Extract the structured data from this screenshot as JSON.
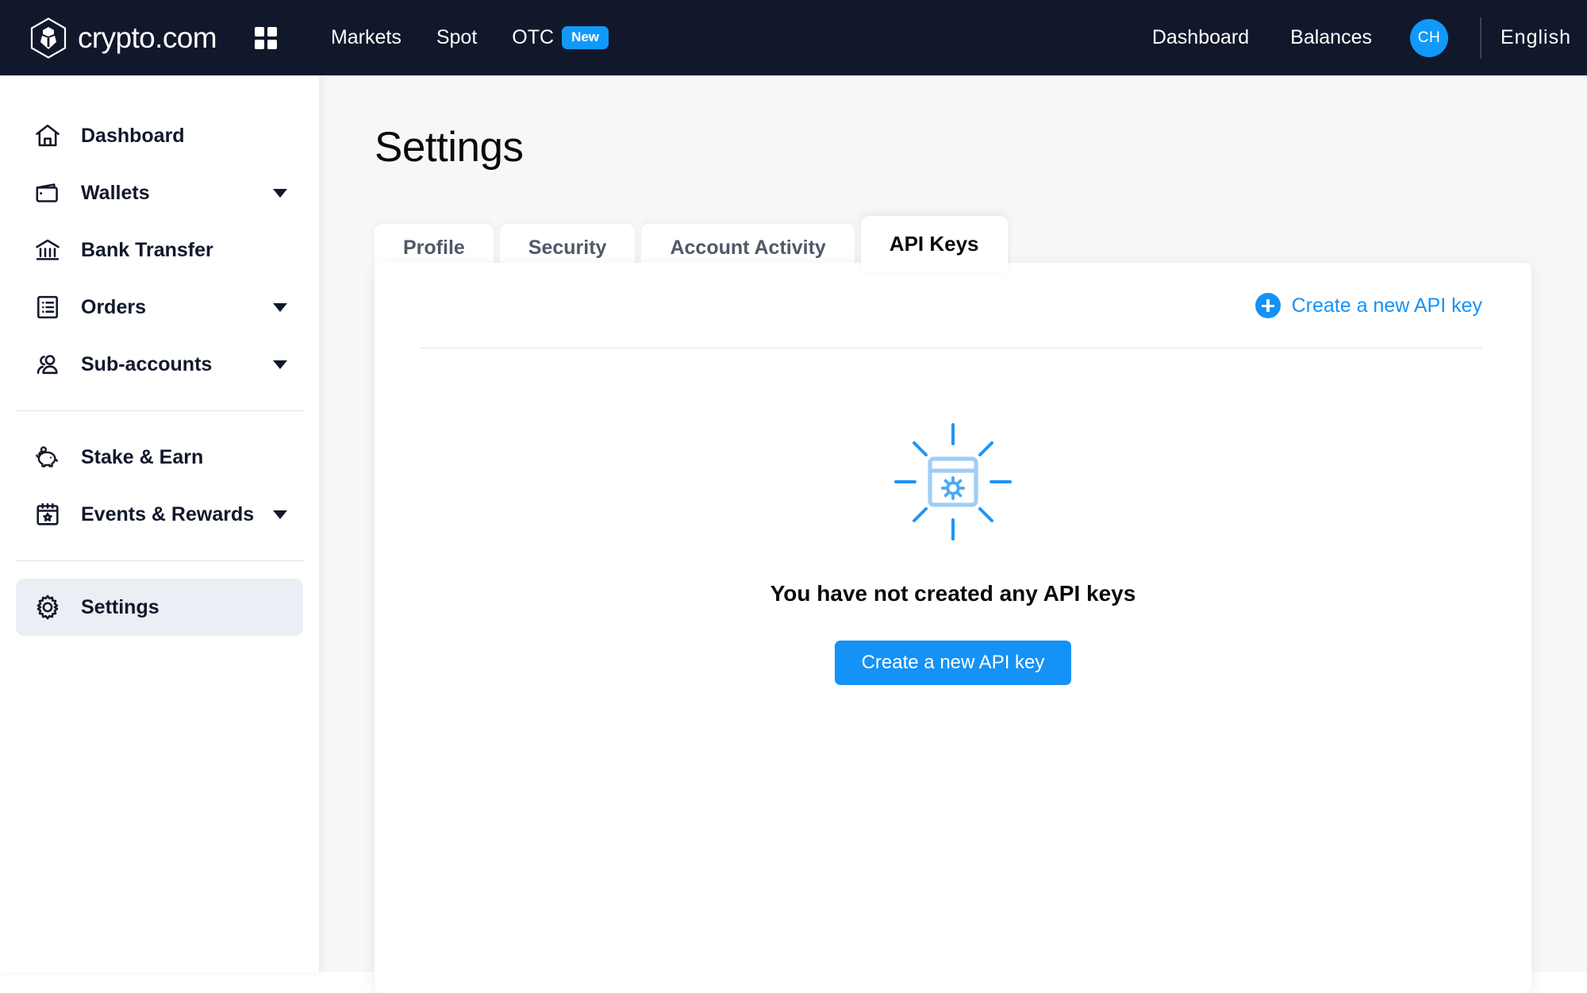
{
  "topnav": {
    "brand_name": "crypto.com",
    "apps_icon": "grid-apps-icon",
    "links": [
      {
        "label": "Markets"
      },
      {
        "label": "Spot"
      },
      {
        "label": "OTC",
        "badge": "New"
      }
    ],
    "right_links": [
      {
        "label": "Dashboard"
      },
      {
        "label": "Balances"
      }
    ],
    "avatar_initials": "CH",
    "language": "English"
  },
  "sidebar": {
    "items": [
      {
        "label": "Dashboard",
        "icon": "home-icon",
        "caret": false,
        "active": false
      },
      {
        "label": "Wallets",
        "icon": "wallet-icon",
        "caret": true,
        "active": false
      },
      {
        "label": "Bank Transfer",
        "icon": "bank-icon",
        "caret": false,
        "active": false
      },
      {
        "label": "Orders",
        "icon": "orders-icon",
        "caret": true,
        "active": false
      },
      {
        "label": "Sub-accounts",
        "icon": "users-icon",
        "caret": true,
        "active": false
      },
      {
        "label": "Stake & Earn",
        "icon": "piggy-bank-icon",
        "caret": false,
        "active": false
      },
      {
        "label": "Events & Rewards",
        "icon": "calendar-star-icon",
        "caret": true,
        "active": false
      },
      {
        "label": "Settings",
        "icon": "gear-icon",
        "caret": false,
        "active": true
      }
    ]
  },
  "main": {
    "page_title": "Settings",
    "tabs": [
      {
        "label": "Profile",
        "active": false
      },
      {
        "label": "Security",
        "active": false
      },
      {
        "label": "Account Activity",
        "active": false
      },
      {
        "label": "API Keys",
        "active": true
      }
    ],
    "card": {
      "create_link_label": "Create a new API key",
      "empty_state": {
        "illustration": "browser-gear-rays-icon",
        "title": "You have not created any API keys",
        "button_label": "Create a new API key"
      }
    }
  },
  "colors": {
    "nav_bg": "#11182b",
    "accent": "#1592f6",
    "badge": "#1199fa",
    "page_bg": "#f7f7f8",
    "sidebar_active": "#eaeef5",
    "text_dark": "#12182b"
  }
}
